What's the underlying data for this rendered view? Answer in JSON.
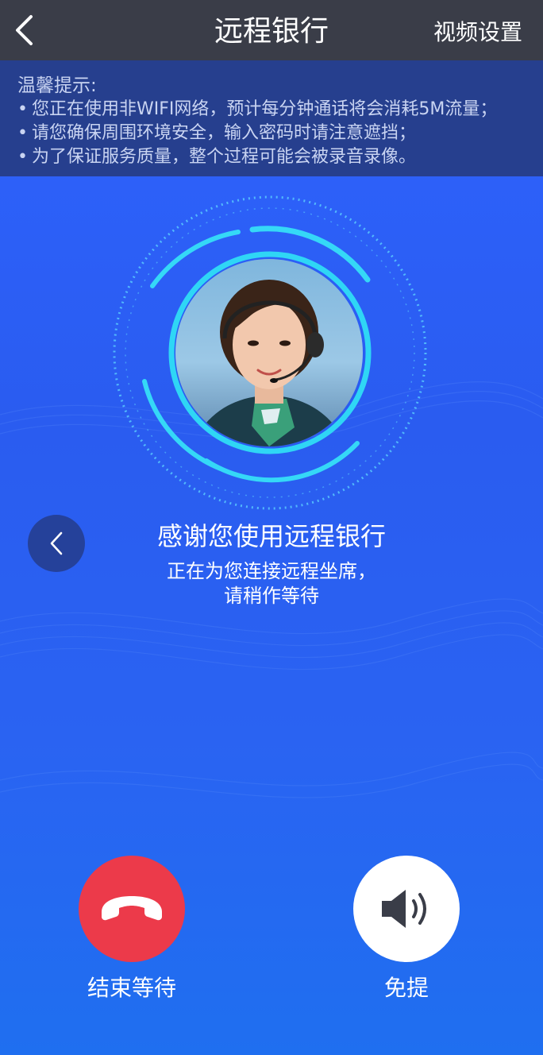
{
  "header": {
    "title": "远程银行",
    "back_icon": "chevron-left-icon",
    "video_settings_label": "视频设置"
  },
  "notice": {
    "title": "温馨提示:",
    "lines": [
      "您正在使用非WIFI网络，预计每分钟通话将会消耗5M流量；",
      "请您确保周围环境安全，输入密码时请注意遮挡；",
      "为了保证服务质量，整个过程可能会被录音录像。"
    ]
  },
  "main": {
    "thanks_text": "感谢您使用远程银行",
    "connecting_lines": [
      "正在为您连接远程坐席，",
      "请稍作等待"
    ]
  },
  "side_arrow_icon": "chevron-left-icon",
  "controls": {
    "end_label": "结束等待",
    "end_icon": "hang-up-phone-icon",
    "speaker_label": "免提",
    "speaker_icon": "speaker-icon"
  },
  "colors": {
    "topbar": "#3a3d48",
    "notice_bg": "#263f8e",
    "background": "#2f63ff",
    "end_button": "#ec3a4a",
    "ring": "#2fd6f5"
  }
}
